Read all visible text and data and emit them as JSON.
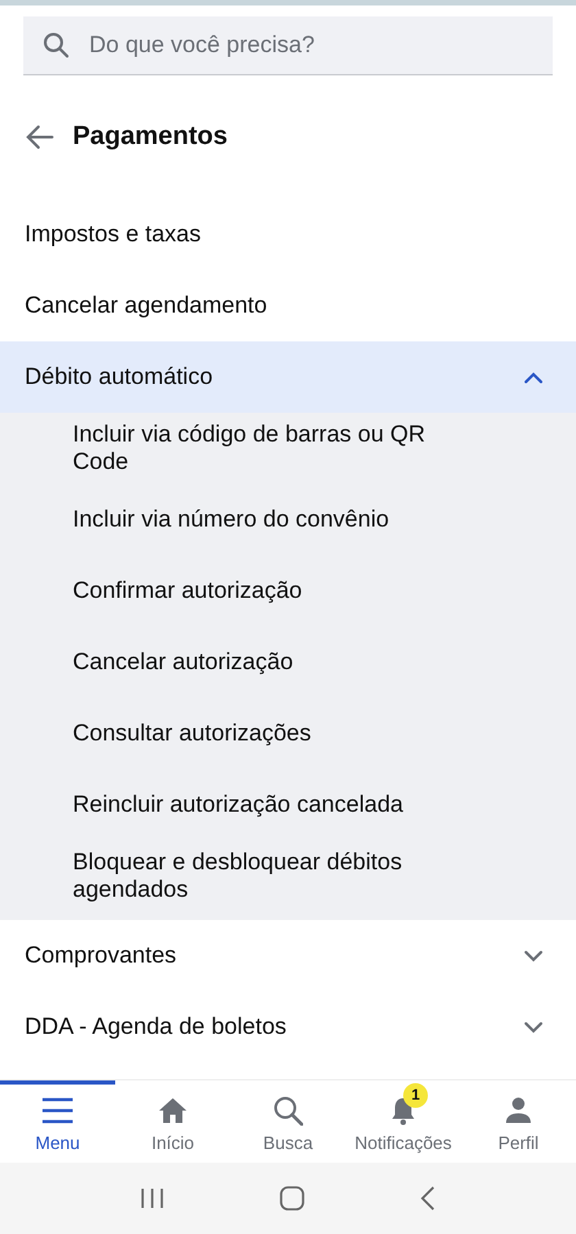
{
  "search": {
    "placeholder": "Do que você precisa?"
  },
  "header": {
    "title": "Pagamentos"
  },
  "menu": [
    {
      "label": "Impostos e taxas",
      "kind": "link"
    },
    {
      "label": "Cancelar agendamento",
      "kind": "link"
    },
    {
      "label": "Débito automático",
      "kind": "group",
      "expanded": true,
      "children": [
        {
          "label": "Incluir via código de barras ou QR Code"
        },
        {
          "label": "Incluir via número do convênio"
        },
        {
          "label": "Confirmar autorização"
        },
        {
          "label": "Cancelar autorização"
        },
        {
          "label": "Consultar autorizações"
        },
        {
          "label": "Reincluir autorização cancelada"
        },
        {
          "label": "Bloquear e desbloquear débitos agendados"
        }
      ]
    },
    {
      "label": "Comprovantes",
      "kind": "group",
      "expanded": false
    },
    {
      "label": "DDA - Agenda de boletos",
      "kind": "group",
      "expanded": false
    }
  ],
  "bottom_nav": [
    {
      "label": "Menu",
      "selected": true
    },
    {
      "label": "Início",
      "selected": false
    },
    {
      "label": "Busca",
      "selected": false
    },
    {
      "label": "Notificações",
      "selected": false,
      "badge": "1"
    },
    {
      "label": "Perfil",
      "selected": false
    }
  ]
}
